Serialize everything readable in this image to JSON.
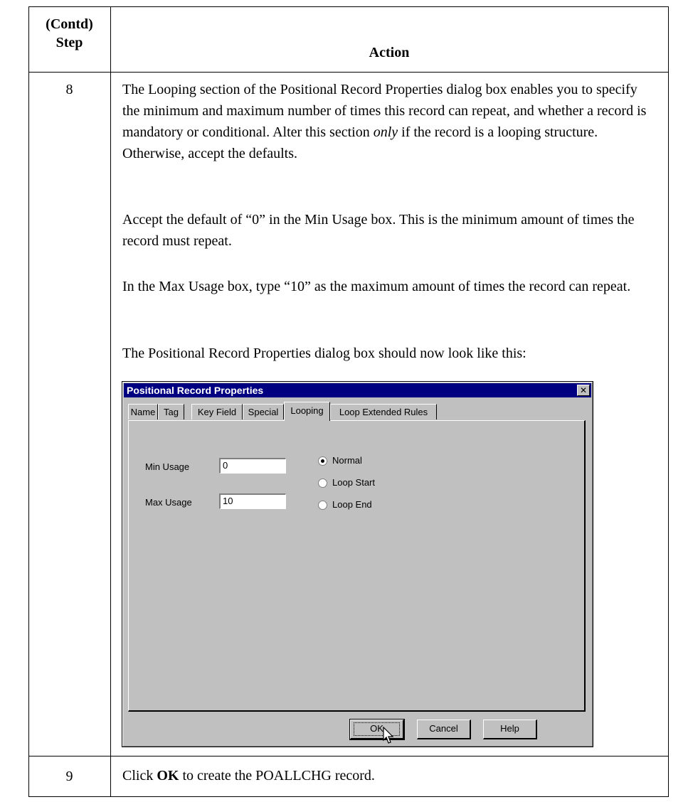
{
  "table": {
    "header": {
      "step_line1": "(Contd)",
      "step_line2": "Step",
      "action": "Action"
    },
    "rows": [
      {
        "step": "8",
        "paragraphs": {
          "p1_a": "The Looping section of the Positional Record Properties dialog box enables you to specify the minimum and maximum number of times this record can repeat, and whether a record is mandatory or conditional. Alter this section ",
          "p1_em": "only",
          "p1_b": " if the record is a looping structure. Otherwise, accept the defaults.",
          "p2": "Accept the default of “0” in the Min Usage box. This is the minimum amount of times the record must repeat.",
          "p3": "In the Max Usage box, type “10” as the maximum amount of times the record can repeat.",
          "p4": "The Positional Record Properties dialog box should now look like this:"
        }
      },
      {
        "step": "9",
        "text_a": "Click ",
        "text_bold": "OK",
        "text_b": " to create the POALLCHG record."
      }
    ]
  },
  "dialog": {
    "title": "Positional Record Properties",
    "close_glyph": "✕",
    "tabs": [
      "Name",
      "Tag",
      "Key Field",
      "Special",
      "Looping",
      "Loop Extended Rules"
    ],
    "active_tab": "Looping",
    "min_usage_label": "Min Usage",
    "min_usage_value": "0",
    "max_usage_label": "Max Usage",
    "max_usage_value": "10",
    "radios": [
      {
        "label": "Normal",
        "checked": true
      },
      {
        "label": "Loop Start",
        "checked": false
      },
      {
        "label": "Loop End",
        "checked": false
      }
    ],
    "buttons": {
      "ok": "OK",
      "cancel": "Cancel",
      "help": "Help"
    }
  }
}
